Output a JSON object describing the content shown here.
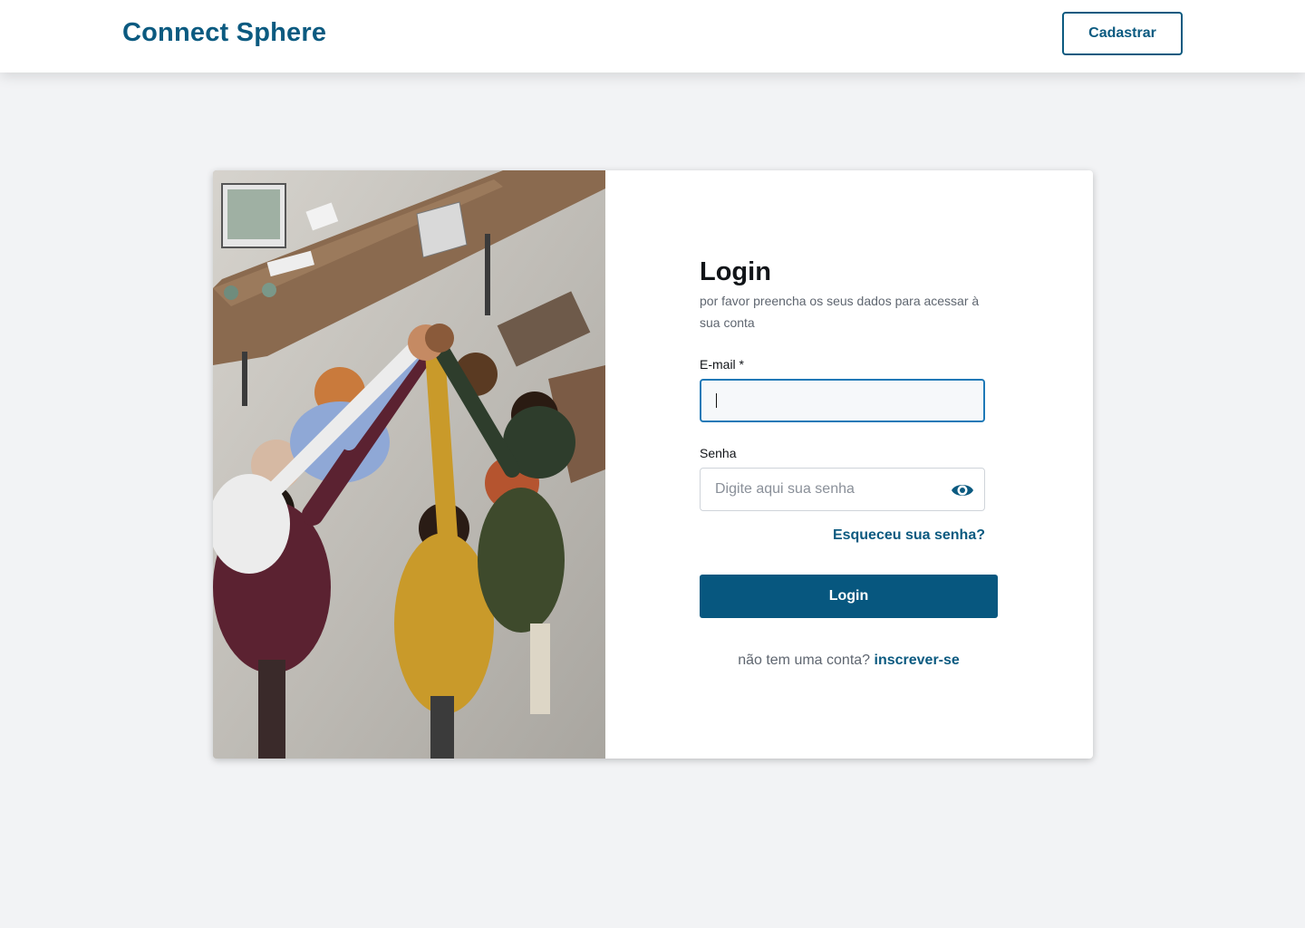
{
  "header": {
    "brand": "Connect Sphere",
    "signup_label": "Cadastrar"
  },
  "login": {
    "title": "Login",
    "subtitle": "por favor preencha os seus dados para acessar à sua conta",
    "email_label": "E-mail *",
    "email_value": "",
    "password_label": "Senha",
    "password_placeholder": "Digite aqui sua senha",
    "forgot_label": "Esqueceu sua senha?",
    "submit_label": "Login",
    "no_account_text": "não tem uma conta?",
    "register_link": "inscrever-se"
  },
  "colors": {
    "brand": "#0b5a80",
    "focus_border": "#1e79b7",
    "button": "#07577f",
    "page_bg": "#f2f3f5"
  },
  "icons": {
    "password_toggle": "eye-icon"
  }
}
